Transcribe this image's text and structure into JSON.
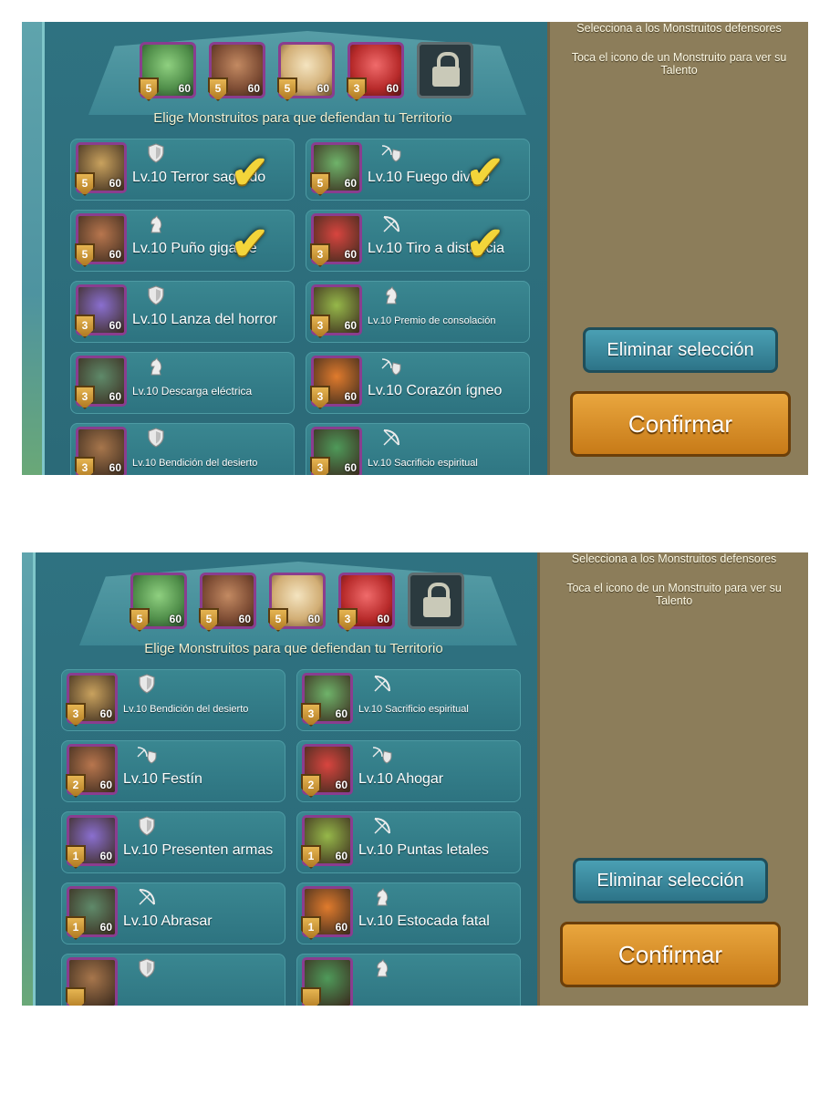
{
  "screens": [
    {
      "right_title": "Selecciona a los Monstruitos defensores",
      "right_hint": "Toca el icono de un Monstruito para ver su Talento",
      "subtitle": "Elige Monstruitos para que defiendan tu Territorio",
      "clear_label": "Eliminar selección",
      "confirm_label": "Confirmar",
      "slots": [
        {
          "rank": "5",
          "level": "60"
        },
        {
          "rank": "5",
          "level": "60"
        },
        {
          "rank": "5",
          "level": "60"
        },
        {
          "rank": "3",
          "level": "60"
        }
      ],
      "cards": [
        {
          "name": "Lv.10 Terror sagrado",
          "rank": "5",
          "level": "60",
          "type": "shield-icon",
          "checked": true
        },
        {
          "name": "Lv.10 Fuego divino",
          "rank": "5",
          "level": "60",
          "type": "bow-shield-icon",
          "checked": true
        },
        {
          "name": "Lv.10 Puño gigante",
          "rank": "5",
          "level": "60",
          "type": "knight-icon",
          "checked": true
        },
        {
          "name": "Lv.10 Tiro a distancia",
          "rank": "3",
          "level": "60",
          "type": "bow-icon",
          "checked": true
        },
        {
          "name": "Lv.10 Lanza del horror",
          "rank": "3",
          "level": "60",
          "type": "shield-icon",
          "checked": false
        },
        {
          "name": "Lv.10 Premio de consolación",
          "rank": "3",
          "level": "60",
          "type": "knight-icon",
          "checked": false
        },
        {
          "name": "Lv.10 Descarga eléctrica",
          "rank": "3",
          "level": "60",
          "type": "knight-icon",
          "checked": false
        },
        {
          "name": "Lv.10 Corazón ígneo",
          "rank": "3",
          "level": "60",
          "type": "bow-shield-icon",
          "checked": false
        },
        {
          "name": "Lv.10 Bendición del desierto",
          "rank": "3",
          "level": "60",
          "type": "shield-icon",
          "checked": false
        },
        {
          "name": "Lv.10 Sacrificio espiritual",
          "rank": "3",
          "level": "60",
          "type": "bow-icon",
          "checked": false
        }
      ]
    },
    {
      "right_title": "Selecciona a los Monstruitos defensores",
      "right_hint": "Toca el icono de un Monstruito para ver su Talento",
      "subtitle": "Elige Monstruitos para que defiendan tu Territorio",
      "clear_label": "Eliminar selección",
      "confirm_label": "Confirmar",
      "slots": [
        {
          "rank": "5",
          "level": "60"
        },
        {
          "rank": "5",
          "level": "60"
        },
        {
          "rank": "5",
          "level": "60"
        },
        {
          "rank": "3",
          "level": "60"
        }
      ],
      "cards": [
        {
          "name": "Lv.10 Bendición del desierto",
          "rank": "3",
          "level": "60",
          "type": "shield-icon",
          "checked": false
        },
        {
          "name": "Lv.10 Sacrificio espiritual",
          "rank": "3",
          "level": "60",
          "type": "bow-icon",
          "checked": false
        },
        {
          "name": "Lv.10 Festín",
          "rank": "2",
          "level": "60",
          "type": "bow-shield-icon",
          "checked": false
        },
        {
          "name": "Lv.10 Ahogar",
          "rank": "2",
          "level": "60",
          "type": "bow-shield-icon",
          "checked": false
        },
        {
          "name": "Lv.10 Presenten armas",
          "rank": "1",
          "level": "60",
          "type": "shield-icon",
          "checked": false
        },
        {
          "name": "Lv.10 Puntas letales",
          "rank": "1",
          "level": "60",
          "type": "bow-icon",
          "checked": false
        },
        {
          "name": "Lv.10 Abrasar",
          "rank": "1",
          "level": "60",
          "type": "bow-icon",
          "checked": false
        },
        {
          "name": "Lv.10 Estocada fatal",
          "rank": "1",
          "level": "60",
          "type": "knight-icon",
          "checked": false
        },
        {
          "name": "",
          "rank": "",
          "level": "",
          "type": "shield-icon",
          "checked": false
        },
        {
          "name": "",
          "rank": "",
          "level": "",
          "type": "knight-icon",
          "checked": false
        }
      ]
    }
  ],
  "colors": {
    "accent_check": "#f3d53a",
    "confirm": "#e9a63e",
    "clear": "#4aa0b4"
  }
}
